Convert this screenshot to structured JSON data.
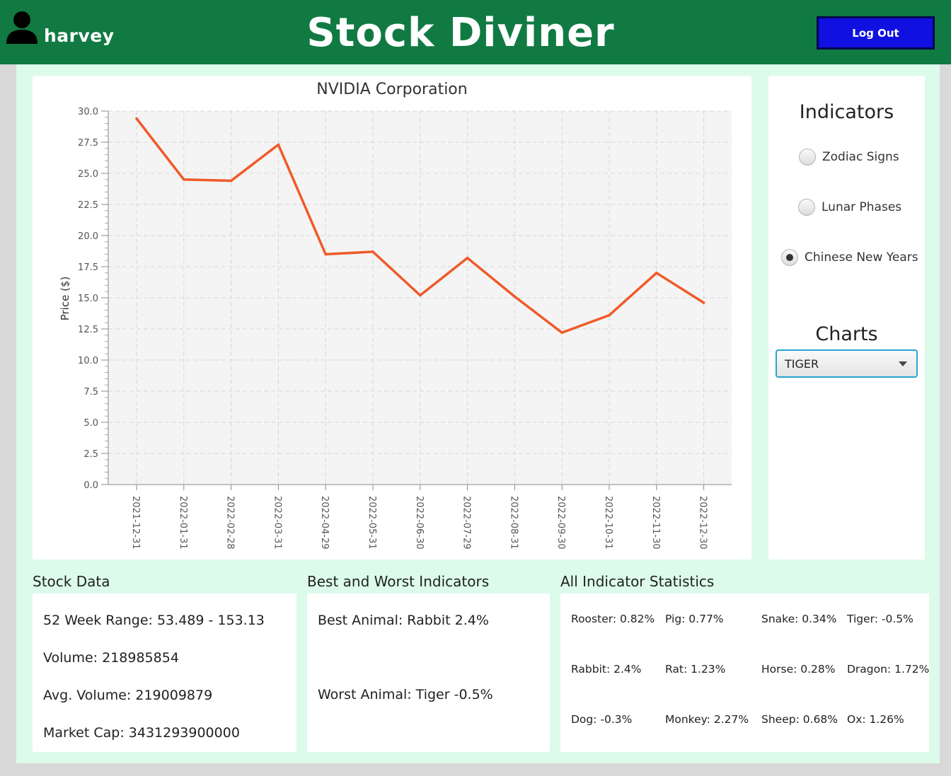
{
  "header": {
    "username": "harvey",
    "app_title": "Stock Diviner",
    "logout_label": "Log Out",
    "bar_color": "#107a42",
    "logout_color": "#1010e0"
  },
  "indicators": {
    "title": "Indicators",
    "options": [
      {
        "label": "Zodiac Signs",
        "selected": false
      },
      {
        "label": "Lunar Phases",
        "selected": false
      },
      {
        "label": "Chinese New Years",
        "selected": true
      }
    ]
  },
  "charts": {
    "title": "Charts",
    "selected": "TIGER"
  },
  "stock_data": {
    "title": "Stock Data",
    "week_range": "52 Week Range: 53.489 - 153.13",
    "volume": "Volume: 218985854",
    "avg_volume": "Avg. Volume: 219009879",
    "market_cap": "Market Cap: 3431293900000"
  },
  "best_worst": {
    "title": "Best and Worst Indicators",
    "best": "Best Animal: Rabbit 2.4%",
    "worst": "Worst Animal: Tiger -0.5%"
  },
  "all_stats": {
    "title": "All Indicator Statistics",
    "rows": [
      [
        "Rooster: 0.82%",
        "Pig: 0.77%",
        "Snake: 0.34%",
        "Tiger: -0.5%"
      ],
      [
        "Rabbit: 2.4%",
        "Rat: 1.23%",
        "Horse: 0.28%",
        "Dragon: 1.72%"
      ],
      [
        "Dog: -0.3%",
        "Monkey: 2.27%",
        "Sheep: 0.68%",
        "Ox: 1.26%"
      ]
    ]
  },
  "chart_data": {
    "type": "line",
    "title": "NVIDIA Corporation",
    "xlabel": "",
    "ylabel": "Price ($)",
    "x": [
      "2021-12-31",
      "2022-01-31",
      "2022-02-28",
      "2022-03-31",
      "2022-04-29",
      "2022-05-31",
      "2022-06-30",
      "2022-07-29",
      "2022-08-31",
      "2022-09-30",
      "2022-10-31",
      "2022-11-30",
      "2022-12-30"
    ],
    "series": [
      {
        "values": [
          29.4,
          24.5,
          24.4,
          27.3,
          18.5,
          18.7,
          15.2,
          18.2,
          15.1,
          12.2,
          13.6,
          17.0,
          14.6
        ]
      }
    ],
    "ylim": [
      0,
      30
    ],
    "yticks": [
      "0.0",
      "2.5",
      "5.0",
      "7.5",
      "10.0",
      "12.5",
      "15.0",
      "17.5",
      "20.0",
      "22.5",
      "25.0",
      "27.5",
      "30.0"
    ],
    "grid": true,
    "line_color": "#f05a28",
    "plot_background": "#f4f4f4"
  }
}
